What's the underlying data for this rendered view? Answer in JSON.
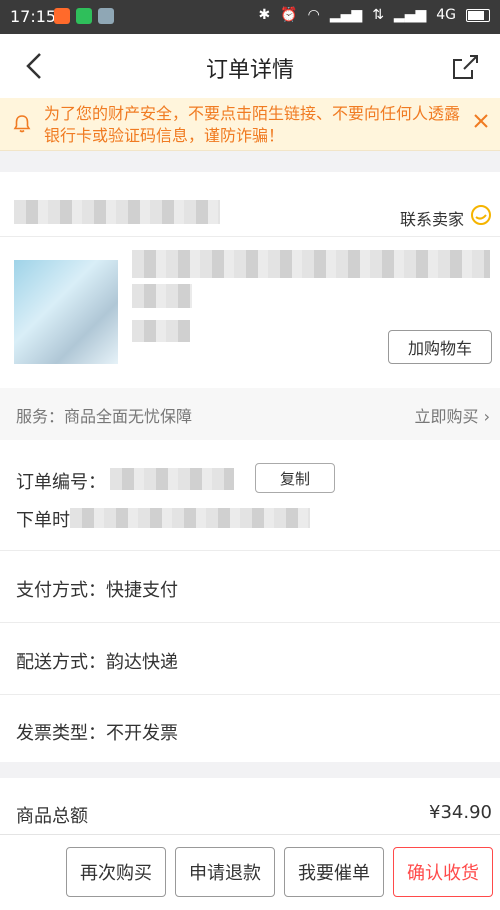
{
  "status_bar": {
    "time": "17:15",
    "network": "4G"
  },
  "nav": {
    "title": "订单详情"
  },
  "notice": {
    "text": "为了您的财产安全，不要点击陌生链接、不要向任何人透露银行卡或验证码信息，谨防诈骗！"
  },
  "store": {
    "contact_label": "联系卖家"
  },
  "product": {
    "add_to_cart_label": "加购物车"
  },
  "service": {
    "label": "服务：商品全面无忧保障",
    "buy_now_label": "立即购买"
  },
  "order_info": {
    "order_no_label": "订单编号：",
    "copy_label": "复制",
    "order_time_label": "下单时间：",
    "payment": "支付方式：快捷支付",
    "delivery": "配送方式：韵达快递",
    "invoice": "发票类型：不开发票"
  },
  "totals": {
    "label": "商品总额",
    "amount": "¥34.90"
  },
  "actions": {
    "rebuy": "再次购买",
    "refund": "申请退款",
    "urge": "我要催单",
    "confirm": "确认收货"
  },
  "colors": {
    "accent": "#ff4a4a",
    "notice_text": "#f07b22",
    "notice_bg": "#fff5dc"
  }
}
